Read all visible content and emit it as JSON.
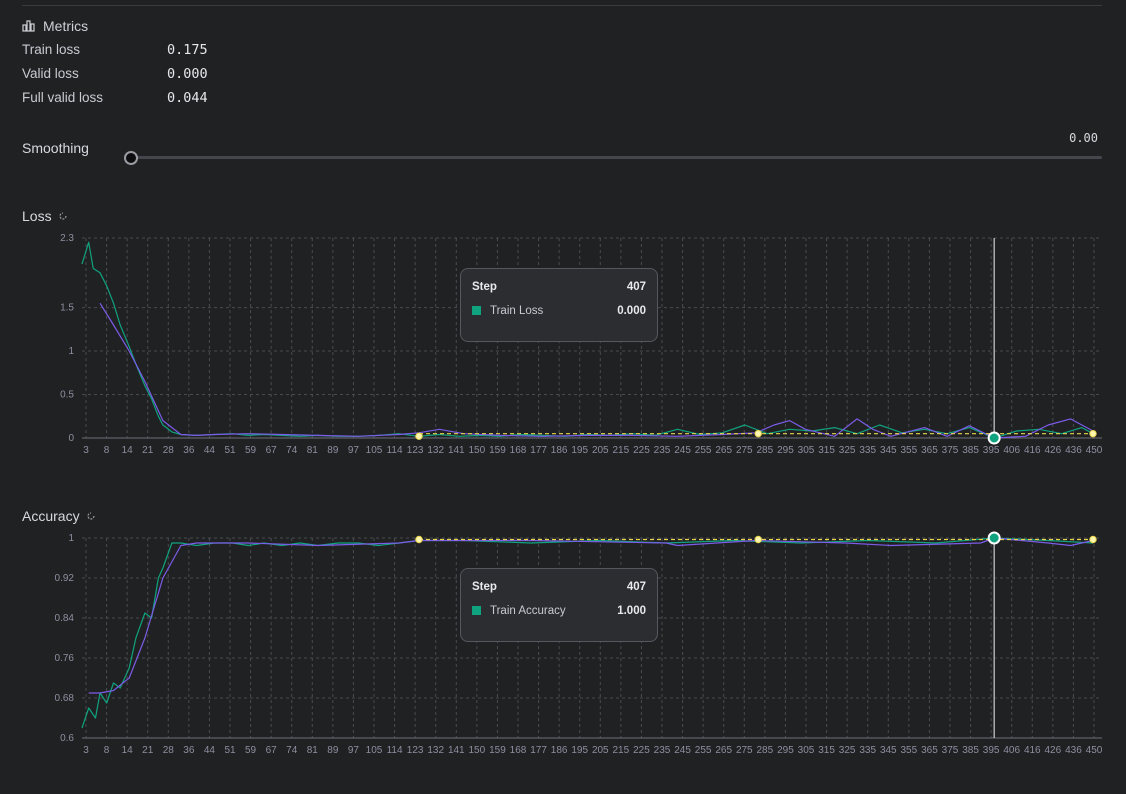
{
  "metrics": {
    "title": "Metrics",
    "rows": [
      {
        "label": "Train loss",
        "value": "0.175"
      },
      {
        "label": "Valid loss",
        "value": "0.000"
      },
      {
        "label": "Full valid loss",
        "value": "0.044"
      }
    ]
  },
  "smoothing": {
    "label": "Smoothing",
    "value": "0.00",
    "level": 0.0
  },
  "colors": {
    "train": "#10a37f",
    "trend": "#7c5ce8",
    "valid": "#e8d44d",
    "grid": "#4a4b52",
    "axis": "#8e8ea0"
  },
  "icons": {
    "metrics": "bar-chart-icon",
    "refresh": "refresh-icon"
  },
  "chart_data": [
    {
      "type": "line",
      "title": "Loss",
      "x_ticks": [
        "3",
        "8",
        "14",
        "21",
        "28",
        "36",
        "44",
        "51",
        "59",
        "67",
        "74",
        "81",
        "89",
        "97",
        "105",
        "114",
        "123",
        "132",
        "141",
        "150",
        "159",
        "168",
        "177",
        "186",
        "195",
        "205",
        "215",
        "225",
        "235",
        "245",
        "255",
        "265",
        "275",
        "285",
        "295",
        "305",
        "315",
        "325",
        "335",
        "345",
        "355",
        "365",
        "375",
        "385",
        "395",
        "406",
        "416",
        "426",
        "436",
        "450"
      ],
      "y_ticks": [
        "2.3",
        "1.5",
        "1",
        "0.5",
        "0"
      ],
      "ylim": [
        0,
        2.3
      ],
      "xlim": [
        0,
        454
      ],
      "grid": true,
      "cursor_step": 406,
      "series": [
        {
          "name": "Train Loss",
          "x": [
            0,
            3,
            5,
            8,
            11,
            14,
            17,
            21,
            24,
            28,
            31,
            34,
            36,
            40,
            44,
            51,
            59,
            67,
            74,
            81,
            89,
            97,
            105,
            114,
            123,
            132,
            141,
            150,
            159,
            168,
            177,
            186,
            195,
            205,
            215,
            225,
            235,
            245,
            255,
            265,
            275,
            285,
            295,
            305,
            315,
            325,
            335,
            345,
            355,
            365,
            375,
            385,
            395,
            406,
            416,
            426,
            436,
            445,
            450
          ],
          "y": [
            2.0,
            2.25,
            1.95,
            1.9,
            1.75,
            1.55,
            1.3,
            1.05,
            0.85,
            0.6,
            0.45,
            0.25,
            0.15,
            0.07,
            0.04,
            0.03,
            0.04,
            0.05,
            0.03,
            0.04,
            0.03,
            0.02,
            0.03,
            0.02,
            0.02,
            0.03,
            0.05,
            0.02,
            0.04,
            0.02,
            0.03,
            0.02,
            0.04,
            0.03,
            0.02,
            0.04,
            0.03,
            0.05,
            0.03,
            0.1,
            0.04,
            0.06,
            0.15,
            0.05,
            0.1,
            0.08,
            0.12,
            0.05,
            0.15,
            0.06,
            0.1,
            0.05,
            0.12,
            0.0,
            0.08,
            0.1,
            0.05,
            0.12,
            0.05
          ]
        },
        {
          "name": "",
          "x": [
            8,
            14,
            21,
            28,
            36,
            44,
            51,
            59,
            74,
            89,
            105,
            123,
            141,
            150,
            159,
            170,
            186,
            205,
            225,
            245,
            265,
            285,
            300,
            308,
            315,
            322,
            335,
            345,
            352,
            360,
            375,
            385,
            395,
            406,
            420,
            430,
            440,
            450
          ],
          "y": [
            1.55,
            1.3,
            1.0,
            0.65,
            0.2,
            0.04,
            0.03,
            0.04,
            0.05,
            0.04,
            0.03,
            0.02,
            0.04,
            0.06,
            0.1,
            0.05,
            0.03,
            0.02,
            0.03,
            0.03,
            0.02,
            0.04,
            0.06,
            0.15,
            0.2,
            0.1,
            0.02,
            0.22,
            0.1,
            0.02,
            0.12,
            0.02,
            0.14,
            0.0,
            0.02,
            0.15,
            0.22,
            0.08
          ]
        },
        {
          "name": "",
          "x": [
            150,
            450
          ],
          "y": [
            0.05,
            0.05
          ]
        }
      ],
      "markers": [
        {
          "x": 150,
          "y": 0.02
        },
        {
          "x": 301,
          "y": 0.05
        },
        {
          "x": 450,
          "y": 0.05
        }
      ],
      "tooltip": {
        "step_label": "Step",
        "step": "407",
        "series": "Train Loss",
        "value": "0.000"
      }
    },
    {
      "type": "line",
      "title": "Accuracy",
      "x_ticks": [
        "3",
        "8",
        "14",
        "21",
        "28",
        "36",
        "44",
        "51",
        "59",
        "67",
        "74",
        "81",
        "89",
        "97",
        "105",
        "114",
        "123",
        "132",
        "141",
        "150",
        "159",
        "168",
        "177",
        "186",
        "195",
        "205",
        "215",
        "225",
        "235",
        "245",
        "255",
        "265",
        "275",
        "285",
        "295",
        "305",
        "315",
        "325",
        "335",
        "345",
        "355",
        "365",
        "375",
        "385",
        "395",
        "406",
        "416",
        "426",
        "436",
        "450"
      ],
      "y_ticks": [
        "1",
        "0.92",
        "0.84",
        "0.76",
        "0.68",
        "0.6"
      ],
      "ylim": [
        0.6,
        1.0
      ],
      "xlim": [
        0,
        454
      ],
      "grid": true,
      "cursor_step": 406,
      "series": [
        {
          "name": "Train Accuracy",
          "x": [
            0,
            3,
            6,
            8,
            11,
            14,
            17,
            21,
            24,
            28,
            31,
            34,
            36,
            40,
            44,
            51,
            59,
            67,
            74,
            81,
            89,
            97,
            105,
            114,
            123,
            132,
            141,
            150,
            170,
            200,
            230,
            260,
            290,
            320,
            350,
            380,
            406,
            430,
            450
          ],
          "y": [
            0.62,
            0.66,
            0.64,
            0.69,
            0.67,
            0.71,
            0.7,
            0.74,
            0.8,
            0.85,
            0.84,
            0.92,
            0.94,
            0.99,
            0.99,
            0.985,
            0.99,
            0.99,
            0.985,
            0.99,
            0.985,
            0.99,
            0.985,
            0.99,
            0.99,
            0.985,
            0.99,
            0.995,
            0.995,
            0.99,
            0.995,
            0.99,
            0.995,
            0.99,
            0.995,
            0.99,
            1.0,
            0.995,
            0.99
          ]
        },
        {
          "name": "",
          "x": [
            3,
            8,
            14,
            21,
            28,
            36,
            44,
            51,
            74,
            105,
            141,
            150,
            200,
            260,
            265,
            300,
            340,
            360,
            400,
            406,
            430,
            440,
            450
          ],
          "y": [
            0.69,
            0.69,
            0.695,
            0.72,
            0.8,
            0.92,
            0.985,
            0.99,
            0.99,
            0.985,
            0.99,
            0.995,
            0.995,
            0.99,
            0.985,
            0.995,
            0.99,
            0.985,
            0.99,
            1.0,
            0.99,
            0.985,
            0.995
          ]
        },
        {
          "name": "",
          "x": [
            150,
            450
          ],
          "y": [
            0.997,
            0.997
          ]
        }
      ],
      "markers": [
        {
          "x": 150,
          "y": 0.997
        },
        {
          "x": 301,
          "y": 0.997
        },
        {
          "x": 450,
          "y": 0.997
        }
      ],
      "tooltip": {
        "step_label": "Step",
        "step": "407",
        "series": "Train Accuracy",
        "value": "1.000"
      }
    }
  ]
}
